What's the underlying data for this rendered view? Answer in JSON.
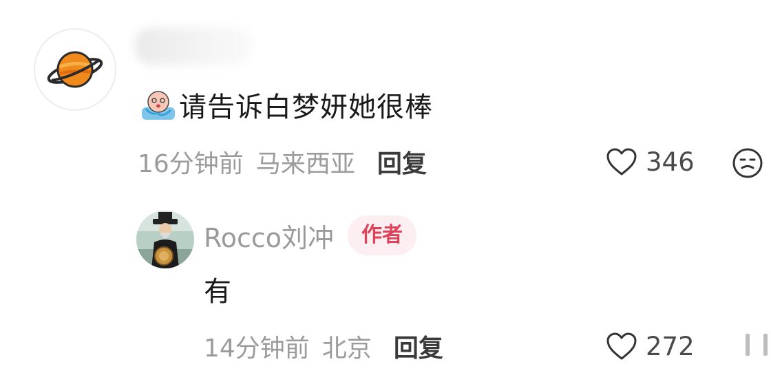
{
  "comment": {
    "text": "请告诉白梦妍她很棒",
    "time": "16分钟前",
    "location": "马来西亚",
    "reply_label": "回复",
    "likes": "346",
    "avatar_icon": "planet-icon",
    "emoji_icon": "crying-emoji-icon",
    "reaction_icon": "smiley-reaction-icon"
  },
  "reply": {
    "author": "Rocco刘冲",
    "badge": "作者",
    "text": "有",
    "time": "14分钟前",
    "location": "北京",
    "reply_label": "回复",
    "likes": "272",
    "avatar_icon": "painting-portrait-avatar"
  },
  "colors": {
    "meta_gray": "#9b9b9b",
    "badge_bg": "#fdeff1",
    "badge_text": "#e0415a",
    "planet_orange": "#f08a1c"
  }
}
